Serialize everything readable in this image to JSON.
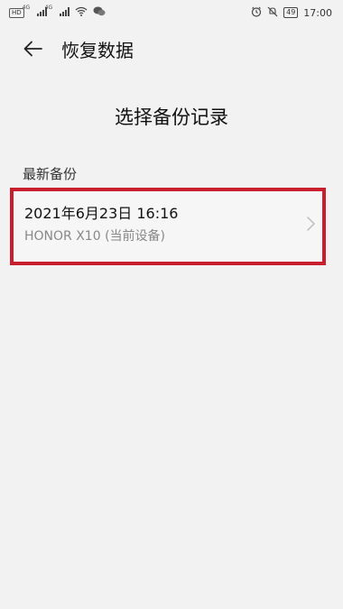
{
  "status_bar": {
    "hd_label": "HD",
    "net_type_1": "4G",
    "net_type_2": "4G",
    "battery_level": "49",
    "time": "17:00"
  },
  "header": {
    "title": "恢复数据"
  },
  "page": {
    "section_title": "选择备份记录",
    "list_header": "最新备份"
  },
  "backups": [
    {
      "date": "2021年6月23日 16:16",
      "device": "HONOR X10 (当前设备)"
    }
  ],
  "colors": {
    "highlight_border": "#c81e2d",
    "background": "#f2f2f2"
  },
  "icons": {
    "back": "back-arrow-icon",
    "chevron": "chevron-right-icon",
    "wifi": "wifi-icon",
    "wechat": "wechat-icon",
    "alarm": "alarm-icon",
    "mute": "mute-icon"
  }
}
